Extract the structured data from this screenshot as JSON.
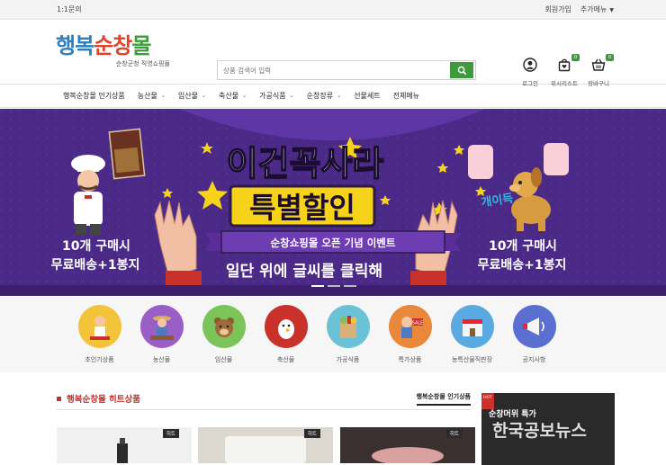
{
  "topbar": {
    "left": "1:1문의",
    "join": "회원가입",
    "more": "추가메뉴"
  },
  "logo": {
    "part1": "행복",
    "part2": "순창",
    "part3": "몰",
    "sub": "순창군청 직영쇼핑몰"
  },
  "search": {
    "placeholder": "상품 검색어 입력"
  },
  "header_icons": [
    {
      "label": "로그인"
    },
    {
      "label": "위시리스트",
      "badge": "0"
    },
    {
      "label": "장바구니",
      "badge": "0"
    }
  ],
  "nav": [
    {
      "label": "행복순창몰 인기상품",
      "has_menu": false
    },
    {
      "label": "농산물",
      "has_menu": true
    },
    {
      "label": "임산물",
      "has_menu": true
    },
    {
      "label": "축산물",
      "has_menu": true
    },
    {
      "label": "가공식품",
      "has_menu": true
    },
    {
      "label": "순창장류",
      "has_menu": true
    },
    {
      "label": "선물세트",
      "has_menu": false
    },
    {
      "label": "전체메뉴",
      "has_menu": false
    }
  ],
  "banner": {
    "headline1": "이건꼭사라",
    "headline2": "특별할인",
    "ribbon": "순창쇼핑몰 오픈 기념 이벤트",
    "cta": "일단 위에 글씨를 클릭해",
    "left_line1": "10개 구매시",
    "left_line2": "무료배송+1봉지",
    "right_line1": "10개 구매시",
    "right_line2": "무료배송+1봉지",
    "dog_text": "개이득",
    "colors": {
      "bg": "#4a2a86",
      "yellow": "#f6d31a",
      "ribbon": "#6e3db3"
    }
  },
  "categories": [
    {
      "label": "초인기상품",
      "bg": "#f3c33a"
    },
    {
      "label": "농산물",
      "bg": "#9a5fc6"
    },
    {
      "label": "임산물",
      "bg": "#7bc45a"
    },
    {
      "label": "축산물",
      "bg": "#c8322b"
    },
    {
      "label": "가공식품",
      "bg": "#6bc2d6"
    },
    {
      "label": "특가상품",
      "bg": "#e9873a"
    },
    {
      "label": "농특산물직판장",
      "bg": "#5aa9e0"
    },
    {
      "label": "공지사항",
      "bg": "#5b6fd0"
    }
  ],
  "hit": {
    "title": "행복순창몰 히트상품",
    "tab": "행복순창몰 인기상품",
    "product_tags": [
      "히트",
      "히트",
      "히트"
    ],
    "side_hot": "HOT",
    "side_title": "순창머위 특가",
    "watermark": "한국공보뉴스"
  }
}
